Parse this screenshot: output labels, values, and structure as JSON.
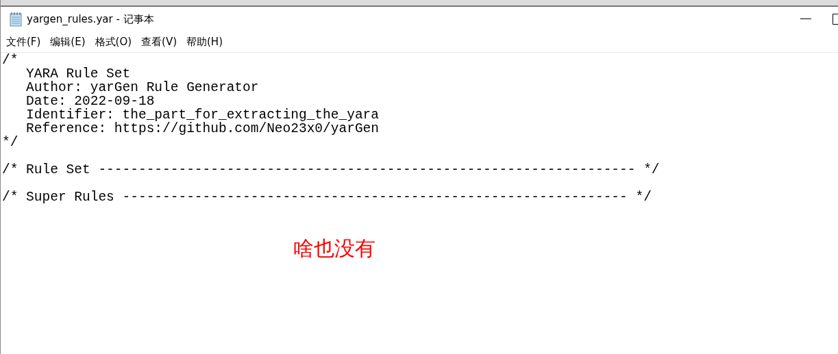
{
  "window": {
    "title": "yargen_rules.yar - 记事本"
  },
  "menu": [
    "文件(F)",
    "编辑(E)",
    "格式(O)",
    "查看(V)",
    "帮助(H)"
  ],
  "editor": {
    "blocks": [
      {
        "lines": [
          "/*",
          "   YARA Rule Set",
          "   Author: yarGen Rule Generator",
          "   Date: 2022-09-18",
          "   Identifier: the_part_for_extracting_the_yara",
          "   Reference: https://github.com/Neo23x0/yarGen",
          "*/"
        ]
      },
      {
        "lines": [
          "/* Rule Set ------------------------------------------------------------------- */"
        ]
      },
      {
        "lines": [
          "/* Super Rules --------------------------------------------------------------- */"
        ]
      }
    ]
  },
  "annotation": {
    "text": "啥也没有"
  }
}
